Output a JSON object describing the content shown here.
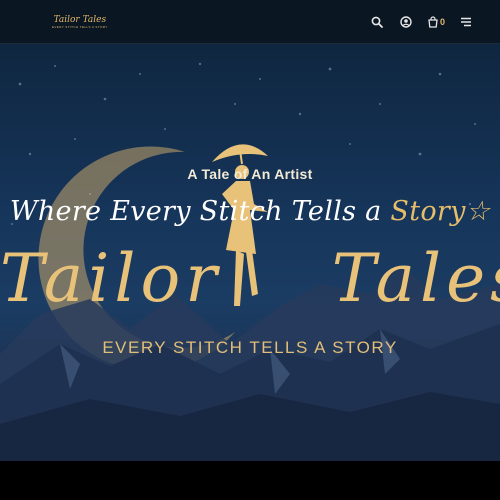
{
  "header": {
    "logo_text": "Tailor Tales",
    "logo_subtitle": "EVERY STITCH TELLS A STORY",
    "icons": [
      "search-icon",
      "account-icon",
      "cart-icon",
      "menu-icon"
    ],
    "cart_count": "0"
  },
  "hero": {
    "kicker": "A Tale of An Artist",
    "headline_white": "Where Every Stitch Tells a",
    "headline_gold": "Story",
    "headline_star": "☆",
    "brand_left": "Tailor",
    "brand_right": "Tales",
    "tagline": "EVERY STITCH TELLS A STORY"
  },
  "colors": {
    "gold": "#e6bd6b",
    "header_bg": "#0b1623",
    "sky": "#16355a"
  }
}
